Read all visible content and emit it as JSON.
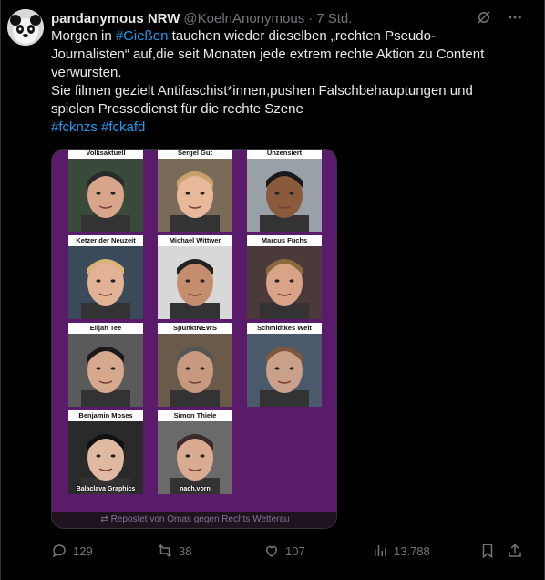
{
  "author": {
    "name": "pandanymous NRW",
    "handle": "@KoelnAnonymous",
    "separator": "·",
    "time": "7 Std."
  },
  "tweet": {
    "line1_before": "Morgen in ",
    "line1_link": "#Gießen",
    "line1_after": " tauchen wieder dieselben „rechten Pseudo-",
    "line2": "Journalisten“ auf,die seit Monaten jede extrem rechte Aktion zu Content",
    "line3": "verwursten.",
    "line4": "Sie filmen gezielt Antifaschist*innen,pushen Falschbehauptungen und",
    "line5": "spielen Pressedienst für die rechte Szene",
    "hashtag1": "#fcknzs",
    "hashtag2": "#fckafd"
  },
  "media": {
    "background_color": "#5a1c6a",
    "people": [
      {
        "label": "Volksaktuell",
        "caption": ""
      },
      {
        "label": "Sergel Gut",
        "caption": ""
      },
      {
        "label": "Unzensiert",
        "caption": ""
      },
      {
        "label": "Ketzer der Neuzeit",
        "caption": ""
      },
      {
        "label": "Michael Wittwer",
        "caption": ""
      },
      {
        "label": "Marcus Fuchs",
        "caption": ""
      },
      {
        "label": "Elijah Tee",
        "caption": ""
      },
      {
        "label": "SpunktNEWS",
        "caption": ""
      },
      {
        "label": "Schmidtkes Welt",
        "caption": ""
      },
      {
        "label": "Benjamin Moses",
        "caption": "Balaclava Graphics"
      },
      {
        "label": "Simon Thiele",
        "caption": "nach.vorn"
      }
    ],
    "repost_text": "Repostet von Omas gegen Rechts Wetterau"
  },
  "actions": {
    "replies": "129",
    "reposts": "38",
    "likes": "107",
    "views": "13.788"
  }
}
